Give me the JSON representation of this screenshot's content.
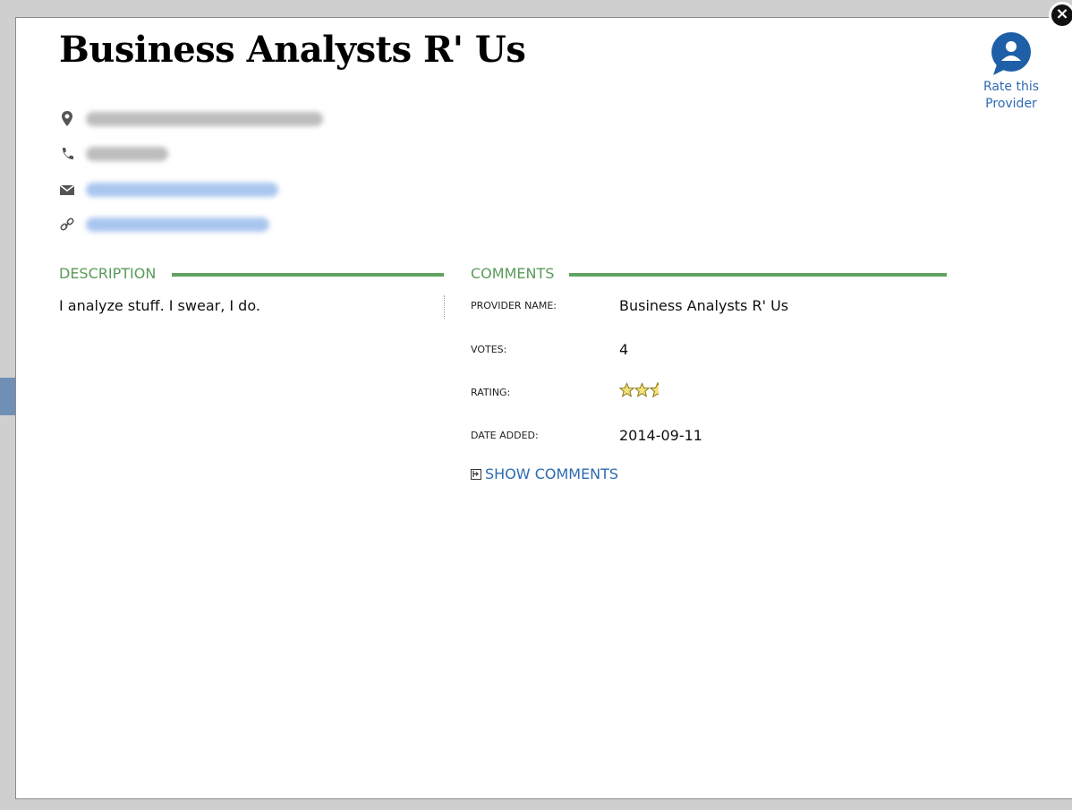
{
  "modal": {
    "title": "Business Analysts R' Us",
    "close_symbol": "×",
    "rate_button": {
      "line1": "Rate this",
      "line2": "Provider",
      "icon": "user-speech-bubble-icon"
    }
  },
  "contact": {
    "address_icon": "map-pin-icon",
    "phone_icon": "phone-icon",
    "email_icon": "envelope-icon",
    "website_icon": "link-icon"
  },
  "description": {
    "heading": "DESCRIPTION",
    "text": "I analyze stuff. I swear, I do."
  },
  "comments": {
    "heading": "COMMENTS",
    "fields": {
      "provider_name_label": "PROVIDER NAME:",
      "provider_name_value": "Business Analysts R' Us",
      "votes_label": "VOTES:",
      "votes_value": "4",
      "rating_label": "RATING:",
      "rating_value": 2.5,
      "rating_max": 3,
      "date_label": "DATE ADDED:",
      "date_value": "2014-09-11"
    },
    "show_comments": "SHOW COMMENTS"
  },
  "colors": {
    "accent_green": "#5fa35f",
    "link_blue": "#2e6bb3",
    "star_fill": "#f3e07a"
  }
}
